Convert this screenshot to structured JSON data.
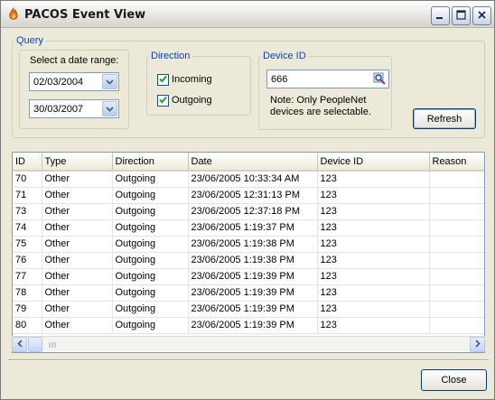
{
  "window": {
    "title": "PACOS Event View"
  },
  "query": {
    "legend": "Query",
    "date_range_label": "Select a date range:",
    "from_date": "02/03/2004",
    "to_date": "30/03/2007"
  },
  "direction": {
    "legend": "Direction",
    "incoming_label": "Incoming",
    "incoming_checked": true,
    "outgoing_label": "Outgoing",
    "outgoing_checked": true
  },
  "device": {
    "legend": "Device ID",
    "value": "666",
    "note_line1": "Note: Only PeopleNet",
    "note_line2": "devices are selectable."
  },
  "buttons": {
    "refresh": "Refresh",
    "close": "Close"
  },
  "table": {
    "columns": [
      "ID",
      "Type",
      "Direction",
      "Date",
      "Device ID",
      "Reason"
    ],
    "rows": [
      [
        "70",
        "Other",
        "Outgoing",
        "23/06/2005 10:33:34 AM",
        "123",
        ""
      ],
      [
        "71",
        "Other",
        "Outgoing",
        "23/06/2005 12:31:13 PM",
        "123",
        ""
      ],
      [
        "73",
        "Other",
        "Outgoing",
        "23/06/2005 12:37:18 PM",
        "123",
        ""
      ],
      [
        "74",
        "Other",
        "Outgoing",
        "23/06/2005 1:19:37 PM",
        "123",
        ""
      ],
      [
        "75",
        "Other",
        "Outgoing",
        "23/06/2005 1:19:38 PM",
        "123",
        ""
      ],
      [
        "76",
        "Other",
        "Outgoing",
        "23/06/2005 1:19:38 PM",
        "123",
        ""
      ],
      [
        "77",
        "Other",
        "Outgoing",
        "23/06/2005 1:19:39 PM",
        "123",
        ""
      ],
      [
        "78",
        "Other",
        "Outgoing",
        "23/06/2005 1:19:39 PM",
        "123",
        ""
      ],
      [
        "79",
        "Other",
        "Outgoing",
        "23/06/2005 1:19:39 PM",
        "123",
        ""
      ],
      [
        "80",
        "Other",
        "Outgoing",
        "23/06/2005 1:19:39 PM",
        "123",
        ""
      ]
    ]
  },
  "colors": {
    "group_legend": "#0046d5",
    "window_bg": "#ece9d8",
    "check_mark": "#21a121"
  },
  "icons": {
    "app": "flame-icon",
    "minimize": "minimize-icon",
    "maximize": "maximize-icon",
    "close": "close-icon",
    "dropdown": "chevron-down-icon",
    "lookup": "magnifier-icon",
    "check": "checkmark-icon"
  }
}
